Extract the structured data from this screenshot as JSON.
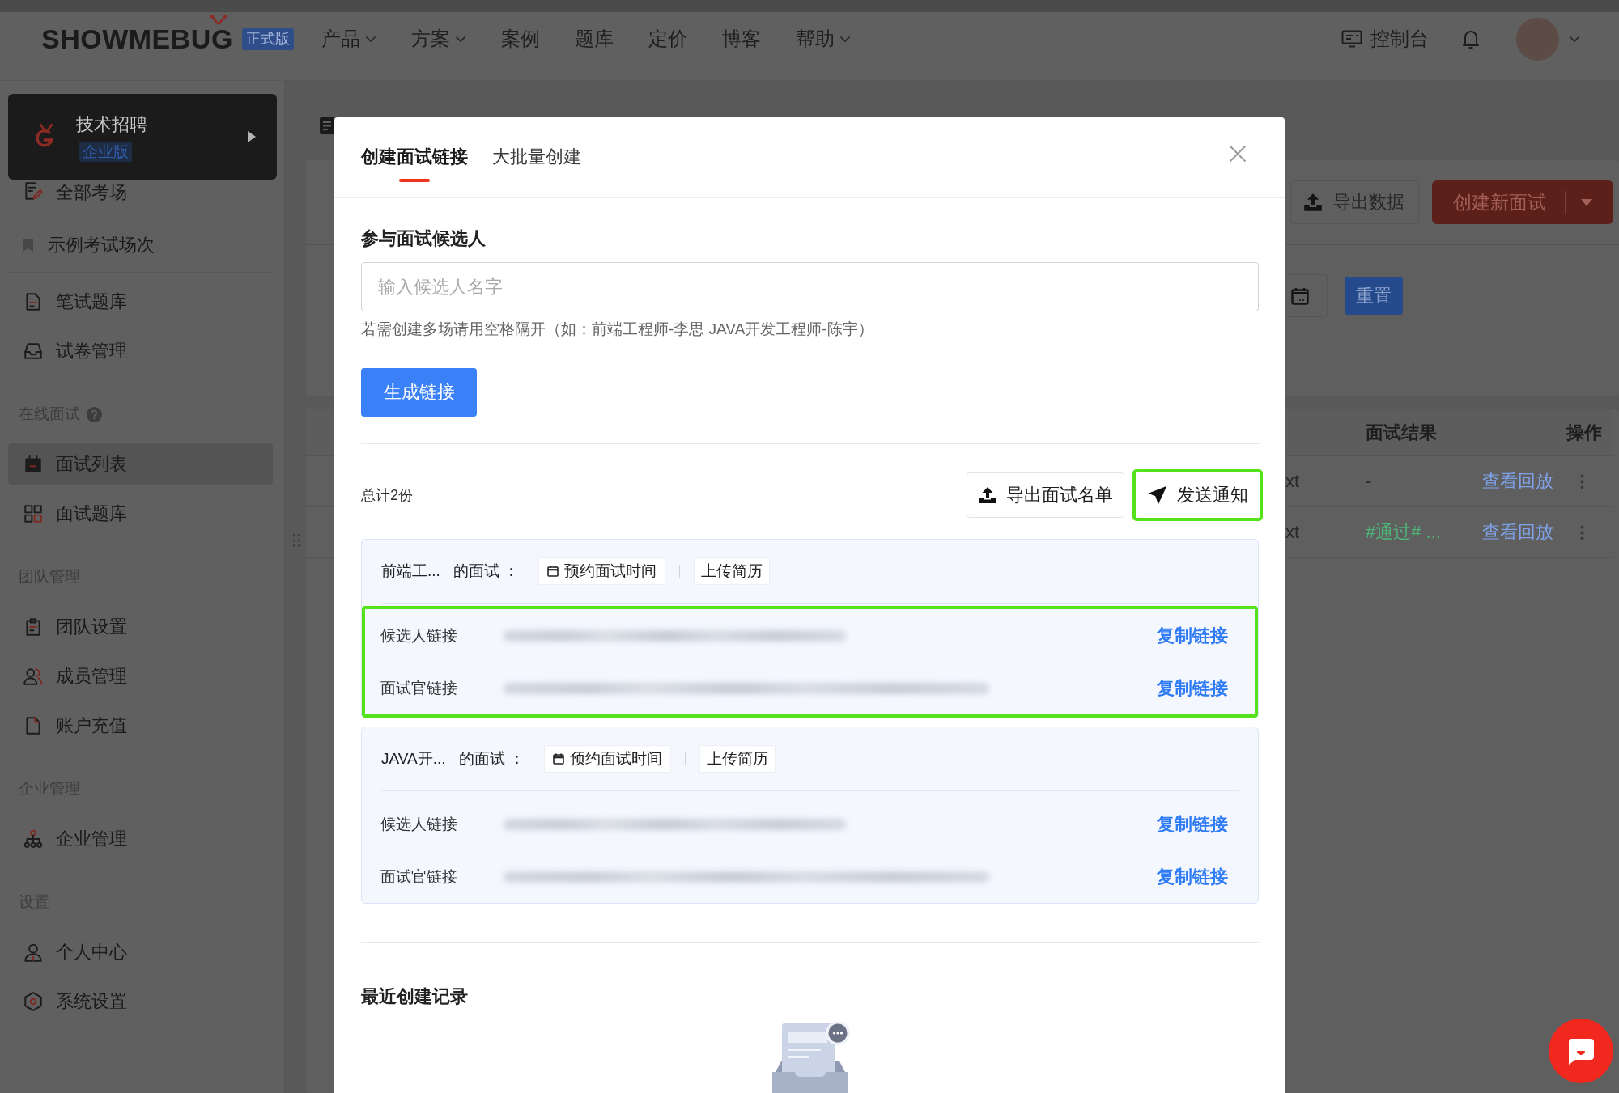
{
  "header": {
    "logo": "SHOWMEBUG",
    "edition": "正式版",
    "nav": [
      {
        "label": "产品",
        "dropdown": true
      },
      {
        "label": "方案",
        "dropdown": true
      },
      {
        "label": "案例",
        "dropdown": false
      },
      {
        "label": "题库",
        "dropdown": false
      },
      {
        "label": "定价",
        "dropdown": false
      },
      {
        "label": "博客",
        "dropdown": false
      },
      {
        "label": "帮助",
        "dropdown": true
      }
    ],
    "console": "控制台"
  },
  "sidebar": {
    "workspace": {
      "name": "技术招聘",
      "edition": "企业版"
    },
    "groups": [
      {
        "items": [
          {
            "label": "全部考场",
            "kind": "section",
            "selected": false
          },
          {
            "label": "示例考试场次",
            "kind": "example",
            "selected": false
          },
          {
            "label": "笔试题库",
            "kind": "link",
            "selected": false
          },
          {
            "label": "试卷管理",
            "kind": "link",
            "selected": false
          }
        ]
      },
      {
        "title": "在线面试",
        "help": true,
        "items": [
          {
            "label": "面试列表",
            "selected": true
          },
          {
            "label": "面试题库",
            "selected": false
          }
        ]
      },
      {
        "title": "团队管理",
        "help": false,
        "items": [
          {
            "label": "团队设置",
            "selected": false
          },
          {
            "label": "成员管理",
            "selected": false
          },
          {
            "label": "账户充值",
            "selected": false
          }
        ]
      },
      {
        "title": "企业管理",
        "help": false,
        "items": [
          {
            "label": "企业管理",
            "selected": false
          }
        ]
      },
      {
        "title": "设置",
        "help": false,
        "items": [
          {
            "label": "个人中心",
            "selected": false
          },
          {
            "label": "系统设置",
            "selected": false
          }
        ]
      }
    ]
  },
  "page": {
    "toolbar": [
      {
        "label": "导出数据",
        "kind": "export"
      },
      {
        "label": "创建新面试",
        "kind": "split"
      }
    ],
    "filters": {
      "reset": "重置"
    },
    "table": {
      "columns": [
        {
          "label": "面试结果"
        },
        {
          "label": "操作"
        }
      ],
      "rows": [
        {
          "column_1": "xt",
          "result": {
            "text": "-",
            "color": "#2b2b2b"
          },
          "action": "查看回放"
        },
        {
          "column_1": "xt",
          "result": {
            "text": "#通过# ...",
            "color": "#4fb477"
          },
          "action": "查看回放"
        }
      ]
    }
  },
  "modal": {
    "tabs": [
      {
        "label": "创建面试链接",
        "selected": true
      },
      {
        "label": "大批量创建",
        "selected": false
      }
    ],
    "candidates": {
      "label": "参与面试候选人",
      "placeholder": "输入候选人名字",
      "hint": "若需创建多场请用空格隔开（如：前端工程师-李思 JAVA开发工程师-陈宇）"
    },
    "generate_button": "生成链接",
    "total": "总计2份",
    "actions": [
      {
        "label": "导出面试名单",
        "kind": "export",
        "highlighted": false
      },
      {
        "label": "发送通知",
        "kind": "send",
        "highlighted": true
      }
    ],
    "interviews": [
      {
        "name": "前端工...",
        "suffix": "的面试 ：",
        "schedule": "预约面试时间",
        "upload": "上传简历",
        "highlighted": true,
        "links": [
          {
            "label": "候选人链接",
            "action": "复制链接"
          },
          {
            "label": "面试官链接",
            "action": "复制链接"
          }
        ]
      },
      {
        "name": "JAVA开...",
        "suffix": "的面试 ：",
        "schedule": "预约面试时间",
        "upload": "上传简历",
        "highlighted": false,
        "links": [
          {
            "label": "候选人链接",
            "action": "复制链接"
          },
          {
            "label": "面试官链接",
            "action": "复制链接"
          }
        ]
      }
    ],
    "recent": {
      "title": "最近创建记录"
    }
  }
}
